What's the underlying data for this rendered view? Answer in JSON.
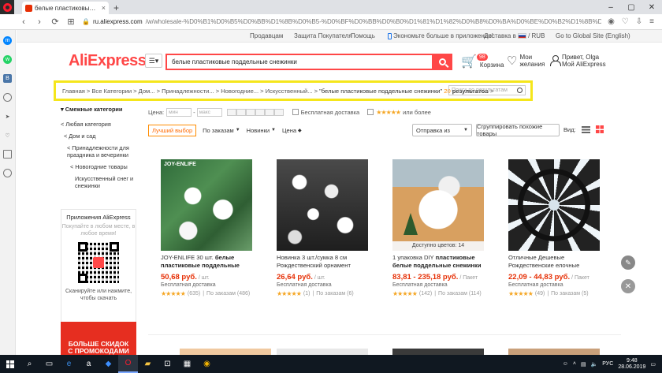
{
  "browser": {
    "tab_title": "белые пластиковые поддельн",
    "tab_close": "×",
    "new_tab": "+",
    "window_controls": [
      "–",
      "▢",
      "✕"
    ],
    "back": "‹",
    "forward": "›",
    "reload": "⟳",
    "tabs_grid": "⊞",
    "url_domain": "ru.aliexpress.com",
    "url_path": "/w/wholesale-%D0%B1%D0%B5%D0%BB%D1%8B%D0%B5-%D0%BF%D0%BB%D0%B0%D1%81%D1%82%D0%B8%D0%BA%D0%BE%D0%B2%D1%8B%D0%B5",
    "addr_right_icons": [
      "camera-icon",
      "heart-icon",
      "download-icon",
      "menu-icon"
    ]
  },
  "topnav": {
    "seller": "Продавцам",
    "protection": "Защита Покупателя",
    "help": "Помощь",
    "app": "Экономьте больше в приложении!",
    "delivery": "Доставка в",
    "currency": "/ RUB",
    "global": "Go to Global Site (English)"
  },
  "header": {
    "logo": "AliExpress",
    "cat_icon": "☰▾",
    "search_value": "белые пластиковые поддельные снежинки",
    "cart_count": "98",
    "cart_label": "Корзина",
    "wish_line1": "Мои",
    "wish_line2": "желания",
    "user_line1": "Привет, Olga",
    "user_line2": "Мой AliExpress"
  },
  "breadcrumb": {
    "items": [
      "Главная",
      "Все Категории",
      "Дом...",
      "Принадлежности...",
      "Новогодние...",
      "Искусственный..."
    ],
    "sep": ">",
    "query": "\"белые пластиковые поддельные снежинки\"",
    "count": "20",
    "results": "результатов",
    "search_placeholder": "Поиск по результатам"
  },
  "leftcol": {
    "heading": "▾ Смежные категории",
    "items": [
      "< Любая категория",
      "< Дом и сад",
      "< Принадлежности для праздника и вечеринки",
      "< Новогодние товары",
      "Искусственный снег и снежинки"
    ]
  },
  "appbox": {
    "title": "Приложения AliExpress",
    "subtitle": "Покупайте в любом месте, в любое время!",
    "caption": "Сканируйте или нажмите, чтобы скачать"
  },
  "promo": {
    "line1": "БОЛЬШЕ СКИДОК",
    "line2": "С ПРОМОКОДАМИ"
  },
  "filters": {
    "price_label": "Цена:",
    "min": "мин",
    "dash": "-",
    "max": "макс",
    "free_ship": "Бесплатная доставка",
    "stars": "★★★★★",
    "or_more": "или более",
    "best": "Лучший выбор",
    "by_orders": "По заказам",
    "newest": "Новинки",
    "price": "Цена",
    "ship_from": "Отправка из",
    "group": "Сгруппировать похожие товары",
    "view": "Вид:"
  },
  "products": [
    {
      "title_plain": "JOY-ENLIFE 30 шт. ",
      "title_bold": "белые пластиковые поддельные",
      "price": "50,68 руб.",
      "unit": " / шт.",
      "ship": "Бесплатная доставка",
      "stars": "★★★★★",
      "reviews": "(635)",
      "orders": "По заказам (486)",
      "img_label": "JOY-ENLIFE"
    },
    {
      "title_plain": "Новинка 3 шт./сумка 8 см Рождественский орнамент",
      "title_bold": "",
      "price": "26,64 руб.",
      "unit": " / шт.",
      "ship": "Бесплатная доставка",
      "stars": "★★★★★",
      "reviews": "(1)",
      "orders": "По заказам (6)"
    },
    {
      "title_plain": "1 упаковка DIY ",
      "title_bold": "пластиковые белые поддельные снежинки",
      "price": "83,81 - 235,18 руб.",
      "unit": " / Пакет",
      "ship": "Бесплатная доставка",
      "stars": "★★★★★",
      "reviews": "(142)",
      "orders": "По заказам (114)",
      "colors": "Доступно цветов: 14"
    },
    {
      "title_plain": "Отличные Дешевые Рождественские елочные",
      "title_bold": "",
      "price": "22,09 - 44,83 руб.",
      "unit": " / Пакет",
      "ship": "Бесплатная доставка",
      "stars": "★★★★★",
      "reviews": "(49)",
      "orders": "По заказам (5)"
    }
  ],
  "float": {
    "edit": "✎",
    "close": "✕"
  },
  "taskbar": {
    "lang": "РУС",
    "time": "9:48",
    "date": "28.06.2019"
  }
}
